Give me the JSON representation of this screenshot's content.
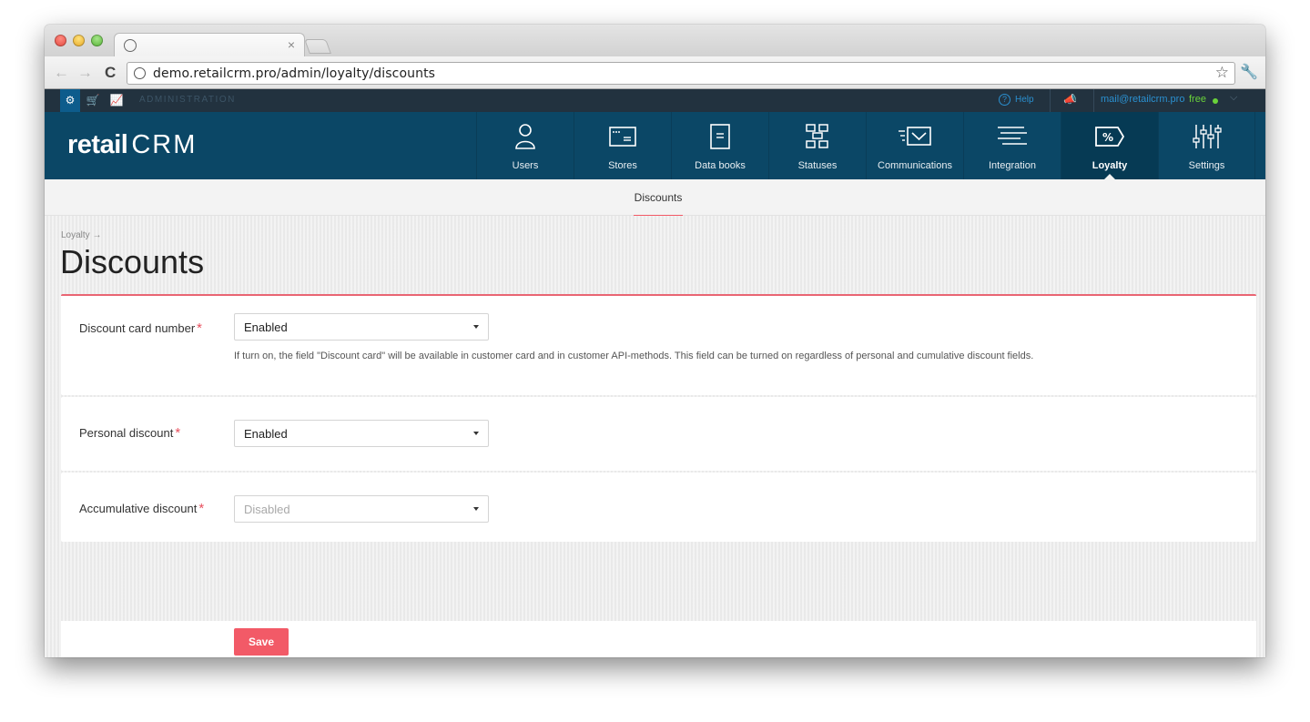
{
  "browser": {
    "url": "demo.retailcrm.pro/admin/loyalty/discounts"
  },
  "topbar": {
    "section_label": "ADMINISTRATION",
    "help_label": "Help",
    "email": "mail@retailcrm.pro",
    "plan": "free"
  },
  "logo": {
    "retail": "retail",
    "crm": "CRM"
  },
  "nav": {
    "items": [
      {
        "label": "Users",
        "icon": "user-icon"
      },
      {
        "label": "Stores",
        "icon": "store-icon"
      },
      {
        "label": "Data books",
        "icon": "book-icon"
      },
      {
        "label": "Statuses",
        "icon": "statuses-icon"
      },
      {
        "label": "Communications",
        "icon": "mail-icon"
      },
      {
        "label": "Integration",
        "icon": "integration-icon"
      },
      {
        "label": "Loyalty",
        "icon": "percent-tag-icon"
      },
      {
        "label": "Settings",
        "icon": "sliders-icon"
      }
    ],
    "active": "Loyalty"
  },
  "subnav": {
    "active_tab": "Discounts"
  },
  "page": {
    "breadcrumb": "Loyalty →",
    "title": "Discounts"
  },
  "form": {
    "discount_card": {
      "label": "Discount card number",
      "required_mark": "*",
      "value": "Enabled",
      "hint": "If turn on, the field \"Discount card\" will be available in customer card and in customer API-methods. This field can be turned on regardless of personal and cumulative discount fields."
    },
    "personal_discount": {
      "label": "Personal discount",
      "required_mark": "*",
      "value": "Enabled"
    },
    "accumulative_discount": {
      "label": "Accumulative discount",
      "required_mark": "*",
      "value": "Disabled"
    },
    "save_label": "Save"
  },
  "colors": {
    "nav_bg": "#0b4766",
    "accent": "#f25a67",
    "topbar_bg": "#22323f"
  }
}
